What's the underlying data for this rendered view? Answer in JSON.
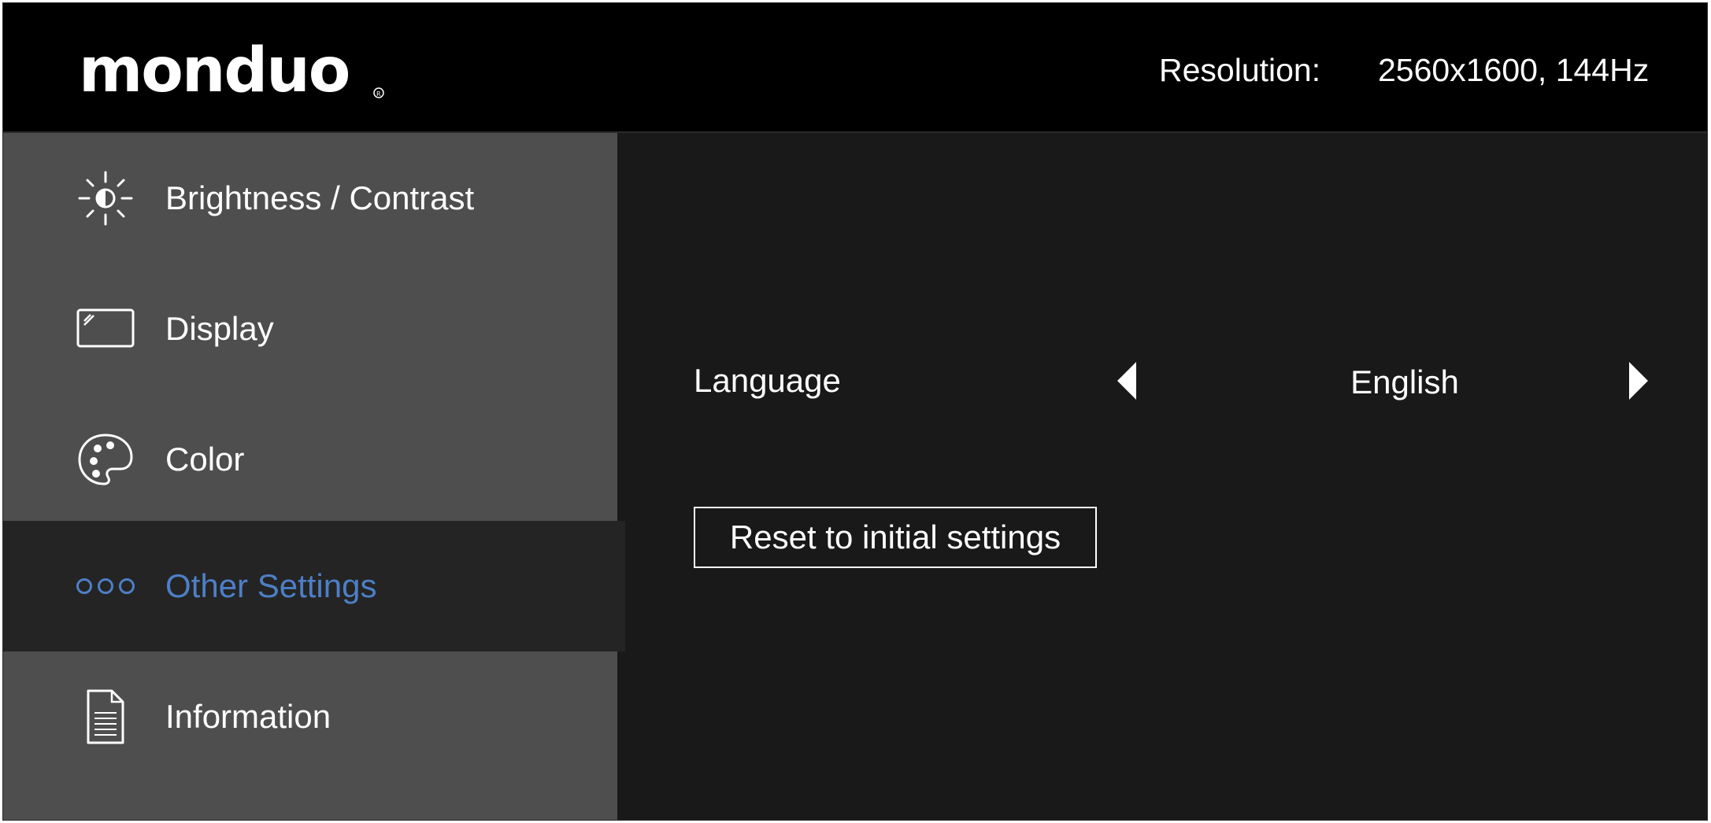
{
  "header": {
    "logo_text": "monduo",
    "resolution_label": "Resolution:",
    "resolution_value": "2560x1600, 144Hz"
  },
  "sidebar": {
    "items": [
      {
        "label": "Brightness / Contrast",
        "icon": "brightness-icon",
        "active": false
      },
      {
        "label": "Display",
        "icon": "display-icon",
        "active": false
      },
      {
        "label": "Color",
        "icon": "palette-icon",
        "active": false
      },
      {
        "label": "Other Settings",
        "icon": "three-dots-icon",
        "active": true
      },
      {
        "label": "Information",
        "icon": "document-icon",
        "active": false
      }
    ]
  },
  "content": {
    "language_label": "Language",
    "language_value": "English",
    "reset_button_label": "Reset to initial settings"
  },
  "colors": {
    "header_bg": "#000000",
    "sidebar_bg": "#4e4e4e",
    "active_item_bg": "#242424",
    "content_bg": "#191919",
    "accent": "#4d7fc6",
    "text": "#ffffff"
  }
}
